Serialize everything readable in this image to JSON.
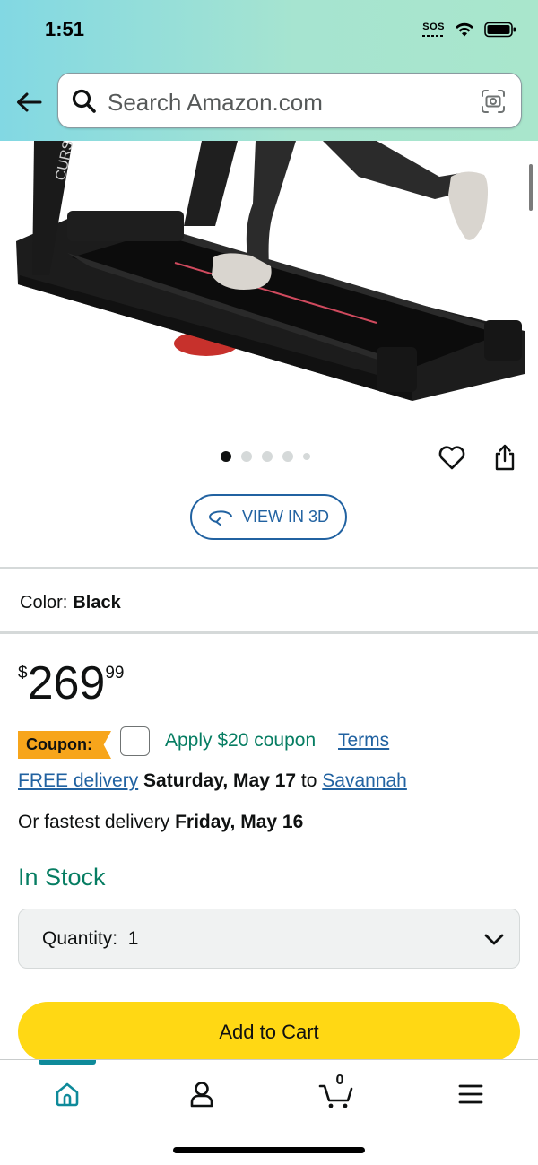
{
  "status_bar": {
    "time": "1:51",
    "sos": "SOS"
  },
  "search": {
    "placeholder": "Search Amazon.com"
  },
  "product": {
    "image_dots_total": 5,
    "image_dots_active": 1,
    "view_3d_label": "VIEW IN 3D",
    "image_brand_text": "CURS"
  },
  "color": {
    "label": "Color:",
    "value": "Black"
  },
  "price": {
    "symbol": "$",
    "whole": "269",
    "fraction": "99"
  },
  "coupon": {
    "tag": "Coupon:",
    "text": "Apply $20 coupon",
    "terms": "Terms"
  },
  "delivery": {
    "free_label": "FREE delivery",
    "date": "Saturday, May 17",
    "to": "to",
    "location": "Savannah",
    "fastest_prefix": "Or fastest delivery",
    "fastest_date": "Friday, May 16"
  },
  "stock": "In Stock",
  "quantity": {
    "label": "Quantity:",
    "value": "1"
  },
  "add_to_cart": "Add to Cart",
  "nav": {
    "cart_count": "0",
    "items": [
      "home-icon",
      "account-icon",
      "cart-icon",
      "menu-icon"
    ]
  },
  "colors": {
    "accent_teal": "#0e8a9a",
    "link": "#2162a1",
    "green": "#067d62",
    "cart_yellow": "#ffd814",
    "coupon_orange": "#f7a51b"
  }
}
